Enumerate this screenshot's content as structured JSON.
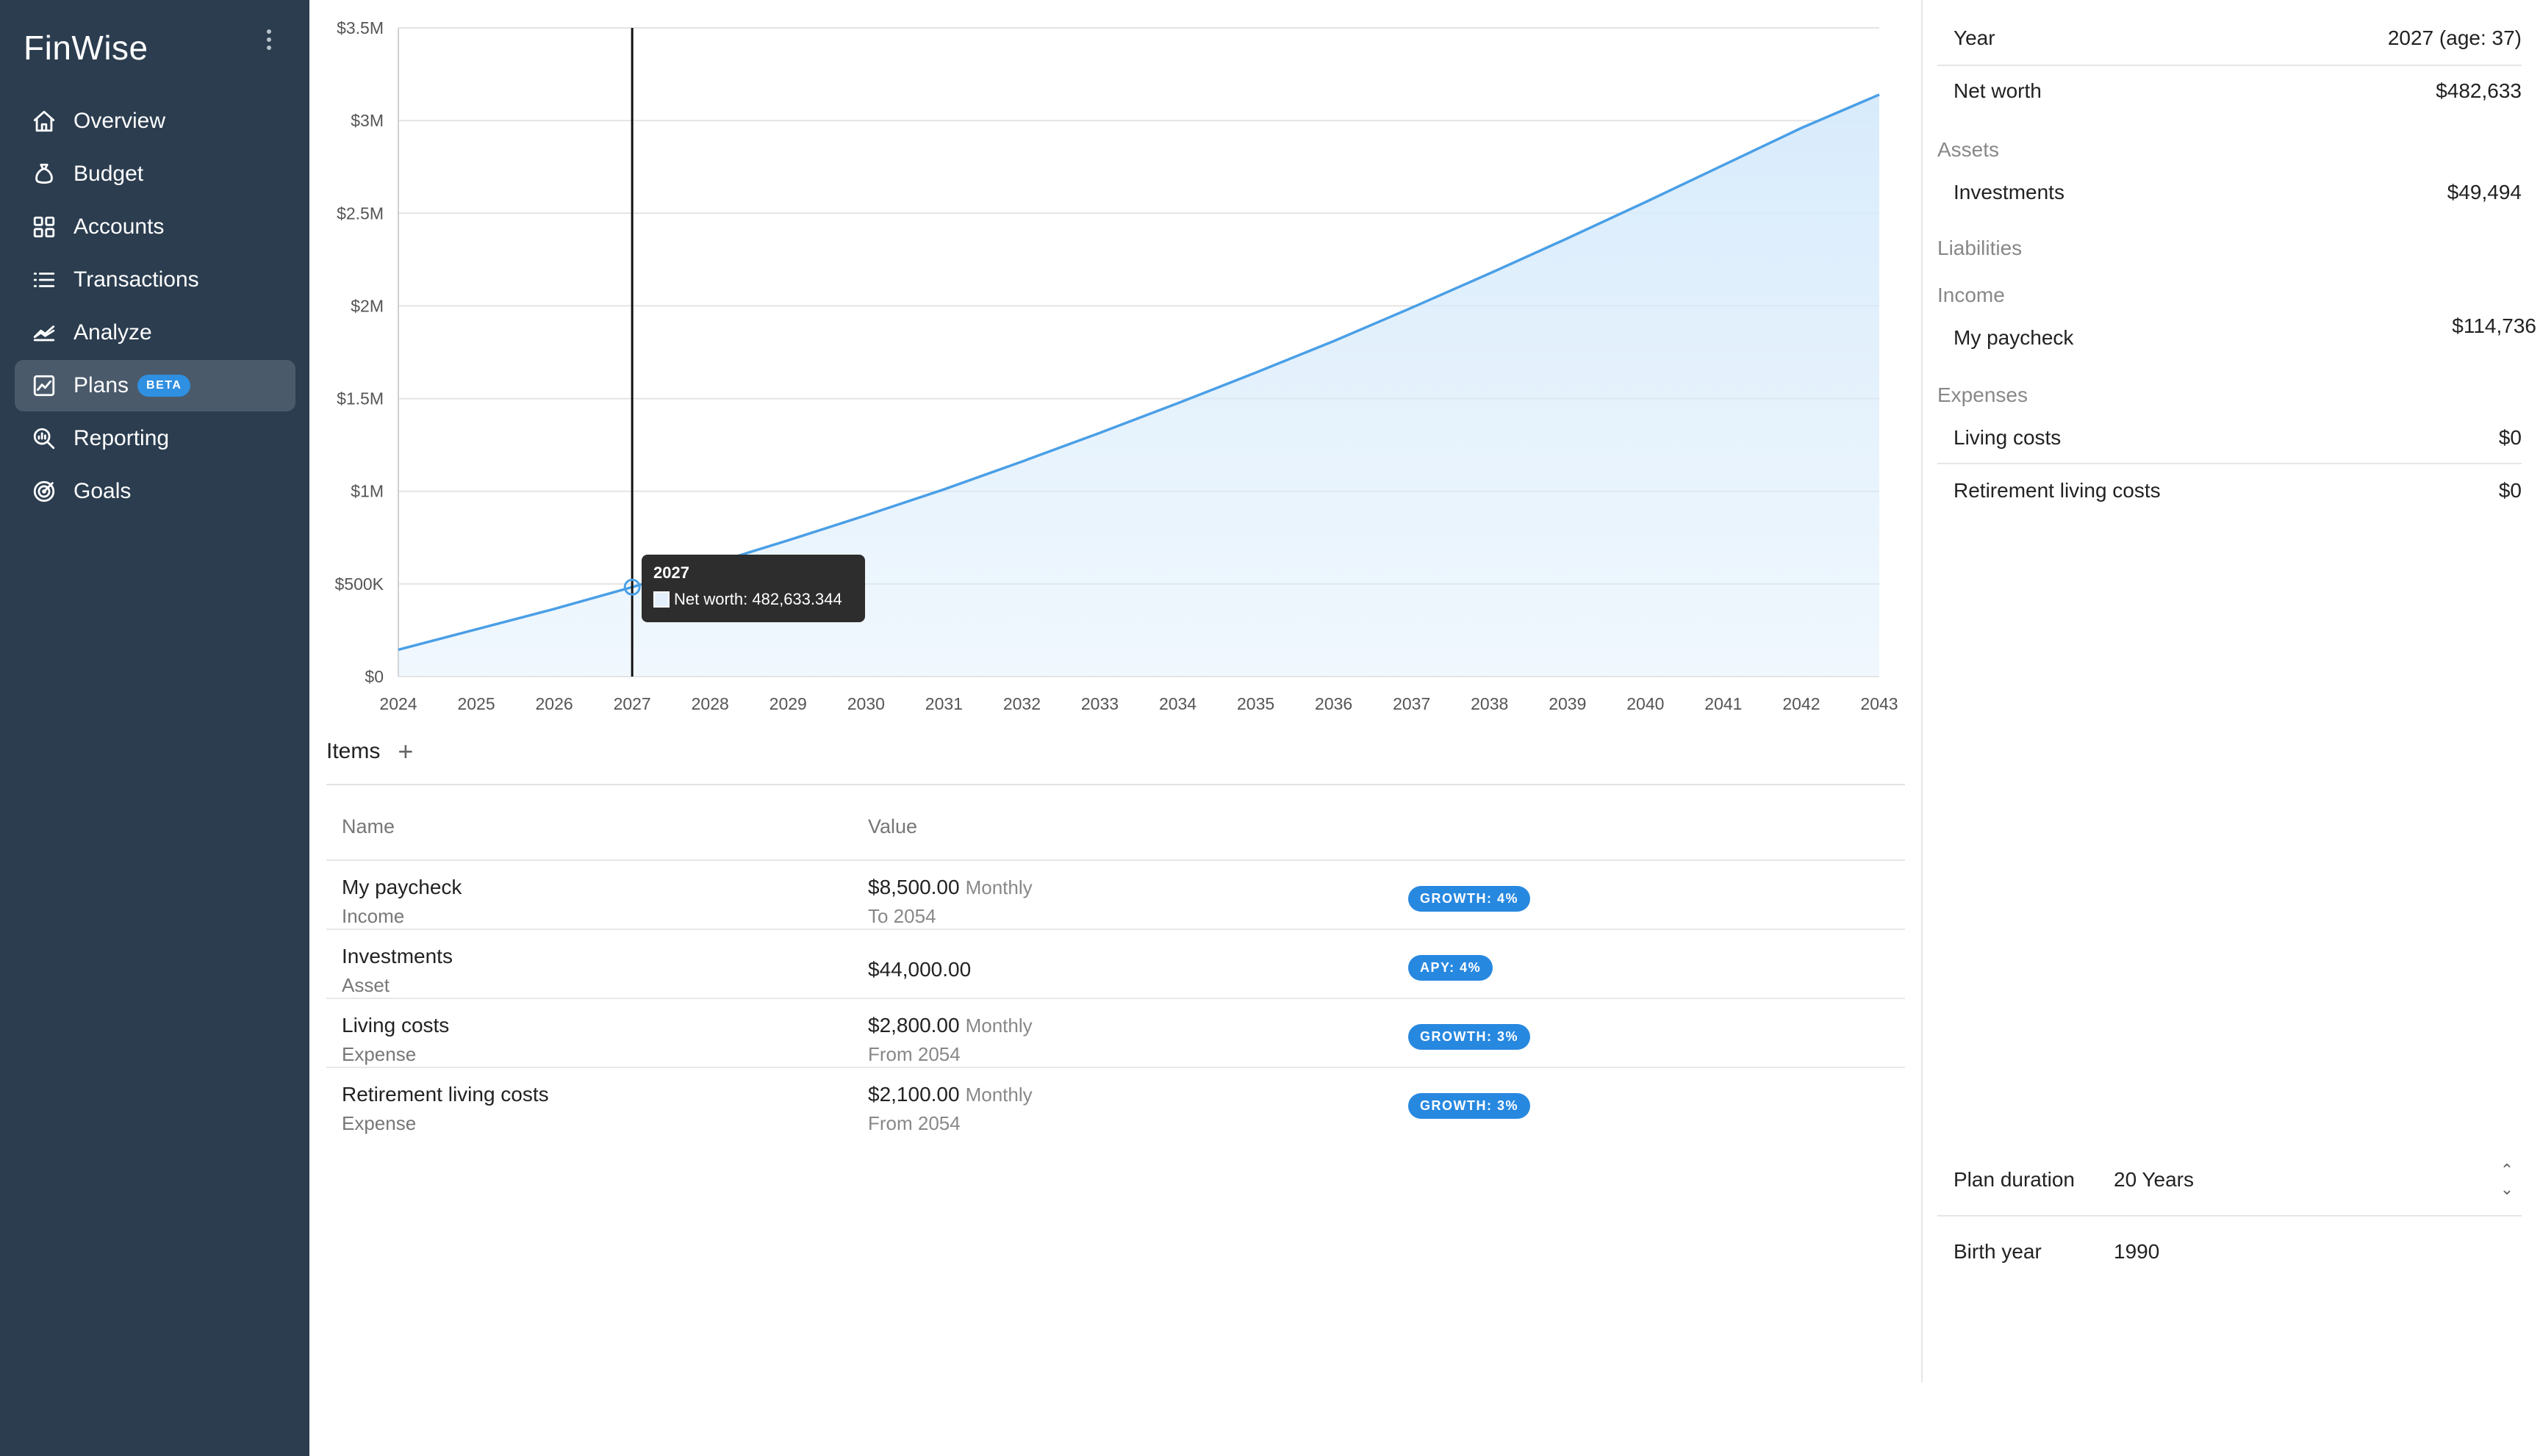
{
  "app": {
    "title": "FinWise"
  },
  "sidebar": {
    "items": [
      {
        "label": "Overview",
        "icon": "home-icon"
      },
      {
        "label": "Budget",
        "icon": "money-bag-icon"
      },
      {
        "label": "Accounts",
        "icon": "grid-icon"
      },
      {
        "label": "Transactions",
        "icon": "list-icon"
      },
      {
        "label": "Analyze",
        "icon": "area-chart-icon"
      },
      {
        "label": "Plans",
        "icon": "line-chart-icon",
        "active": true,
        "badge": "BETA"
      },
      {
        "label": "Reporting",
        "icon": "search-report-icon"
      },
      {
        "label": "Goals",
        "icon": "target-icon"
      }
    ]
  },
  "chart_data": {
    "type": "area",
    "x": [
      2024,
      2025,
      2026,
      2027,
      2028,
      2029,
      2030,
      2031,
      2032,
      2033,
      2034,
      2035,
      2036,
      2037,
      2038,
      2039,
      2040,
      2041,
      2042,
      2043
    ],
    "series": [
      {
        "name": "Net worth",
        "values": [
          145000,
          255000,
          365000,
          482633,
          605000,
          735000,
          870000,
          1010000,
          1160000,
          1315000,
          1475000,
          1640000,
          1810000,
          1990000,
          2175000,
          2365000,
          2560000,
          2760000,
          2960000,
          3140000
        ]
      }
    ],
    "ylim": [
      0,
      3500000
    ],
    "yticks": [
      "$0",
      "$500K",
      "$1M",
      "$1.5M",
      "$2M",
      "$2.5M",
      "$3M",
      "$3.5M"
    ],
    "grid": true,
    "colors": {
      "line": "#4a9fe6",
      "fill": "#d6eafb"
    },
    "hover": {
      "year": "2027",
      "label": "Net worth: 482,633.344"
    }
  },
  "items": {
    "title": "Items",
    "add_label": "+",
    "columns": {
      "name": "Name",
      "value": "Value"
    },
    "rows": [
      {
        "name": "My paycheck",
        "type": "Income",
        "amount": "$8,500.00",
        "freq": "Monthly",
        "sub": "To 2054",
        "badge": "GROWTH: 4%"
      },
      {
        "name": "Investments",
        "type": "Asset",
        "amount": "$44,000.00",
        "freq": "",
        "sub": "",
        "badge": "APY: 4%"
      },
      {
        "name": "Living costs",
        "type": "Expense",
        "amount": "$2,800.00",
        "freq": "Monthly",
        "sub": "From 2054",
        "badge": "GROWTH: 3%"
      },
      {
        "name": "Retirement living costs",
        "type": "Expense",
        "amount": "$2,100.00",
        "freq": "Monthly",
        "sub": "From 2054",
        "badge": "GROWTH: 3%"
      }
    ]
  },
  "details": {
    "year_label": "Year",
    "year_value": "2027 (age: 37)",
    "net_worth_label": "Net worth",
    "net_worth_value": "$482,633",
    "assets_section": "Assets",
    "investments_label": "Investments",
    "investments_value": "$49,494",
    "liabilities_section": "Liabilities",
    "income_section": "Income",
    "paycheck_label": "My paycheck",
    "paycheck_value": "$114,736",
    "expenses_section": "Expenses",
    "living_label": "Living costs",
    "living_value": "$0",
    "retirement_label": "Retirement living costs",
    "retirement_value": "$0"
  },
  "settings": {
    "duration_label": "Plan duration",
    "duration_value": "20 Years",
    "birth_label": "Birth year",
    "birth_value": "1990"
  }
}
